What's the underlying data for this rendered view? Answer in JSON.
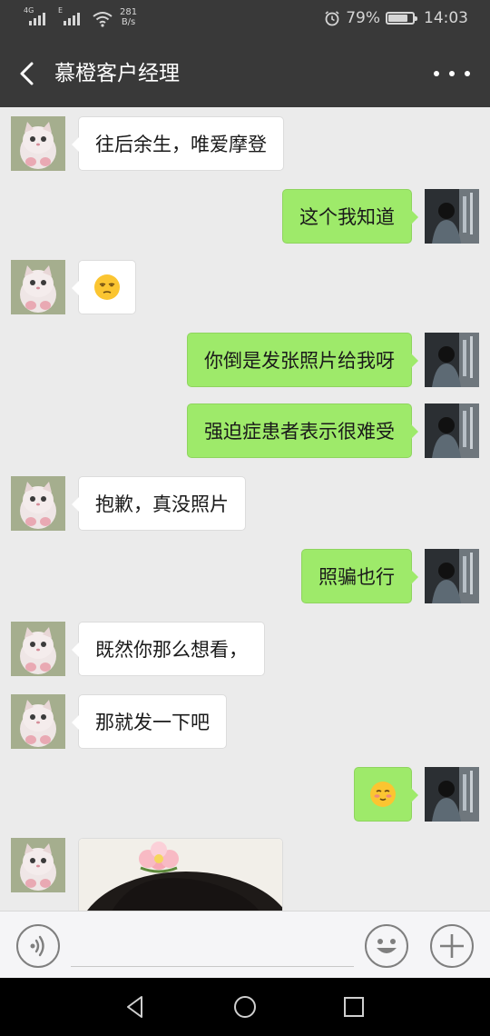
{
  "status_bar": {
    "network_1": "4G",
    "network_2": "E",
    "speed_value": "281",
    "speed_unit": "B/s",
    "battery": "79%",
    "battery_level": 0.79,
    "time": "14:03",
    "icons": [
      "signal-icon",
      "wifi-icon",
      "alarm-icon",
      "battery-icon"
    ]
  },
  "header": {
    "title": "慕橙客户经理",
    "back_icon": "chevron-left-icon",
    "more_icon": "more-dots-icon"
  },
  "messages": [
    {
      "side": "left",
      "type": "text",
      "text": "往后余生，唯爱摩登"
    },
    {
      "side": "right",
      "type": "text",
      "text": "这个我知道"
    },
    {
      "side": "left",
      "type": "emoji",
      "emoji": "unamused-face-icon"
    },
    {
      "side": "right",
      "type": "text",
      "text": "你倒是发张照片给我呀"
    },
    {
      "side": "right",
      "type": "text",
      "text": "强迫症患者表示很难受"
    },
    {
      "side": "left",
      "type": "text",
      "text": "抱歉，真没照片"
    },
    {
      "side": "right",
      "type": "text",
      "text": "照骗也行"
    },
    {
      "side": "left",
      "type": "text",
      "text": "既然你那么想看，"
    },
    {
      "side": "left",
      "type": "text",
      "text": "那就发一下吧"
    },
    {
      "side": "right",
      "type": "emoji",
      "emoji": "blushing-face-icon"
    },
    {
      "side": "left",
      "type": "image",
      "image": "photo-thumbnail"
    }
  ],
  "input_bar": {
    "voice_icon": "voice-icon",
    "emoji_icon": "emoji-face-icon",
    "plus_icon": "plus-icon"
  },
  "nav_bar": {
    "icons": [
      "nav-back-icon",
      "nav-home-icon",
      "nav-recent-icon"
    ]
  },
  "colors": {
    "header_bg": "#393939",
    "chat_bg": "#ebebeb",
    "sent_bubble": "#9eea6a",
    "received_bubble": "#ffffff"
  }
}
